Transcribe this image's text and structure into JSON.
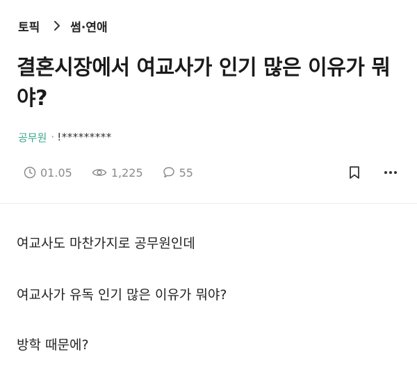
{
  "breadcrumb": {
    "topic": "토픽",
    "category": "썸·연애"
  },
  "post": {
    "title": "결혼시장에서 여교사가 인기 많은 이유가 뭐야?",
    "author_job": "공무원",
    "author_sep": "·",
    "author_id": "!*********",
    "date": "01.05",
    "views": "1,225",
    "comments": "55",
    "body": [
      "여교사도 마찬가지로 공무원인데",
      "여교사가 유독 인기 많은 이유가 뭐야?",
      "방학 때문에?"
    ]
  },
  "icons": {
    "separator": "chevron-right-icon",
    "date": "clock-icon",
    "views": "eye-icon",
    "comments": "comment-icon",
    "bookmark": "bookmark-icon",
    "more": "more-icon"
  },
  "colors": {
    "author_job": "#3aa88a",
    "meta_text": "#8a8a8a",
    "title_text": "#1a1a1a"
  }
}
